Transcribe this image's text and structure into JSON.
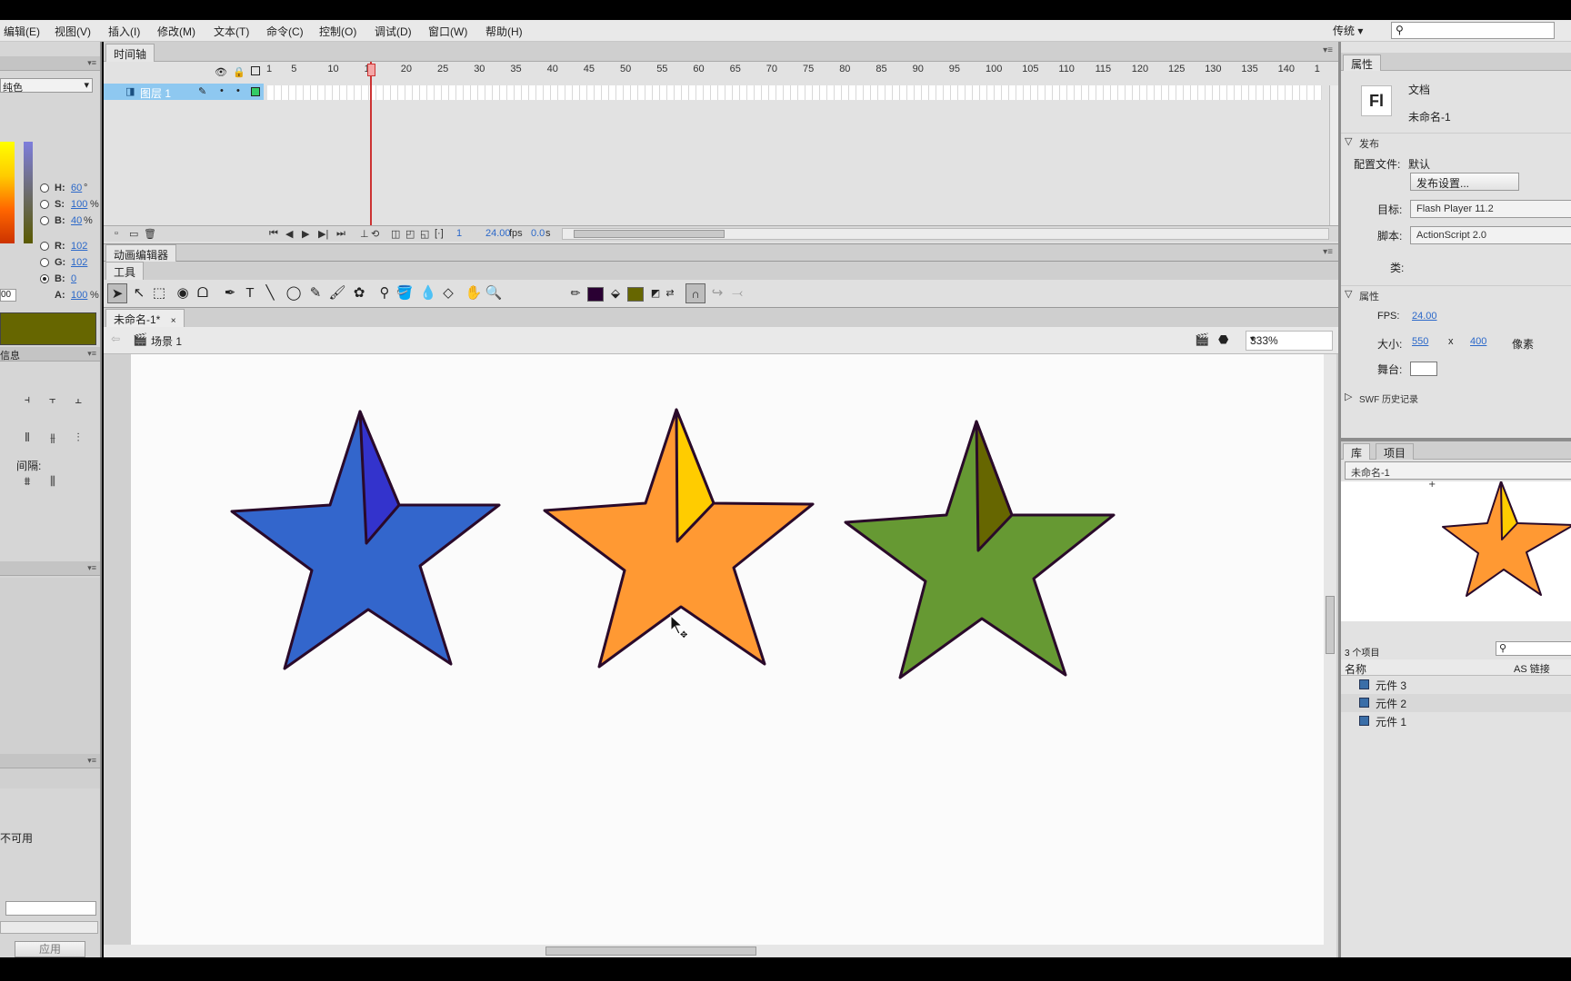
{
  "menu": [
    "编辑(E)",
    "视图(V)",
    "插入(I)",
    "修改(M)",
    "文本(T)",
    "命令(C)",
    "控制(O)",
    "调试(D)",
    "窗口(W)",
    "帮助(H)"
  ],
  "workspace": "传统 ▾",
  "left_panel": {
    "color_mode": "纯色",
    "hsb": [
      {
        "label": "H:",
        "value": "60",
        "unit": "°"
      },
      {
        "label": "S:",
        "value": "100",
        "unit": "%"
      },
      {
        "label": "B:",
        "value": "40",
        "unit": "%"
      }
    ],
    "rgb": [
      {
        "label": "R:",
        "value": "102"
      },
      {
        "label": "G:",
        "value": "102"
      },
      {
        "label": "B:",
        "value": "0"
      }
    ],
    "alpha": {
      "label": "A:",
      "value": "100",
      "unit": "%"
    },
    "hex_value": "00",
    "swatch_color": "#666600",
    "align_title": "信息",
    "spacing_label": "间隔:",
    "unavailable_text": "不可用",
    "apply_button": "应用"
  },
  "timeline": {
    "tab": "时间轴",
    "layer_name": "图层 1",
    "ruler": [
      "1",
      "5",
      "10",
      "15",
      "20",
      "25",
      "30",
      "35",
      "40",
      "45",
      "50",
      "55",
      "60",
      "65",
      "70",
      "75",
      "80",
      "85",
      "90",
      "95",
      "100",
      "105",
      "110",
      "115",
      "120",
      "125",
      "130",
      "135",
      "140",
      "1"
    ],
    "current_frame": "1",
    "fps": "24.00",
    "fps_unit": "fps",
    "time": "0.0",
    "time_unit": "s"
  },
  "motion_editor_tab": "动画编辑器",
  "tools_label": "工具",
  "tools": [
    {
      "name": "selection-tool",
      "glyph": "➤"
    },
    {
      "name": "subselection-tool",
      "glyph": "↖"
    },
    {
      "name": "free-transform-tool",
      "glyph": "⬚"
    },
    {
      "name": "3d-rotation-tool",
      "glyph": "◉"
    },
    {
      "name": "lasso-tool",
      "glyph": "ᗝ"
    },
    {
      "name": "pen-tool",
      "glyph": "✒"
    },
    {
      "name": "text-tool",
      "glyph": "T"
    },
    {
      "name": "line-tool",
      "glyph": "╲"
    },
    {
      "name": "oval-tool",
      "glyph": "◯"
    },
    {
      "name": "pencil-tool",
      "glyph": "✎"
    },
    {
      "name": "brush-tool",
      "glyph": "🖌"
    },
    {
      "name": "deco-tool",
      "glyph": "✿"
    },
    {
      "name": "bone-tool",
      "glyph": "⚲"
    },
    {
      "name": "paint-bucket-tool",
      "glyph": "🪣"
    },
    {
      "name": "eyedropper-tool",
      "glyph": "💧"
    },
    {
      "name": "eraser-tool",
      "glyph": "◇"
    },
    {
      "name": "hand-tool",
      "glyph": "✋"
    },
    {
      "name": "zoom-tool",
      "glyph": "🔍"
    }
  ],
  "stroke_color": "#2a0033",
  "fill_color": "#666600",
  "document_tab": "未命名-1*",
  "scene": "场景 1",
  "zoom": "333%",
  "stars": [
    {
      "fill": "#3366cc",
      "shade": "#3333cc"
    },
    {
      "fill": "#ff9933",
      "shade": "#ffcc00"
    },
    {
      "fill": "#669933",
      "shade": "#666600"
    }
  ],
  "properties": {
    "tab": "属性",
    "doc_type": "文档",
    "doc_name": "未命名-1",
    "publish_section": "发布",
    "profile_label": "配置文件:",
    "profile_value": "默认",
    "publish_settings_button": "发布设置...",
    "target_label": "目标:",
    "target_value": "Flash Player 11.2",
    "script_label": "脚本:",
    "script_value": "ActionScript 2.0",
    "class_label": "类:",
    "props_section": "属性",
    "fps_label": "FPS:",
    "fps_value": "24.00",
    "size_label": "大小:",
    "width": "550",
    "x": "x",
    "height": "400",
    "size_unit": "像素",
    "stage_label": "舞台:",
    "swf_history": "SWF 历史记录"
  },
  "library": {
    "tab": "库",
    "tab2": "项目",
    "doc": "未命名-1",
    "count": "3 个项目",
    "col_name": "名称",
    "col_link": "AS 链接",
    "items": [
      "元件 3",
      "元件 2",
      "元件 1"
    ]
  }
}
